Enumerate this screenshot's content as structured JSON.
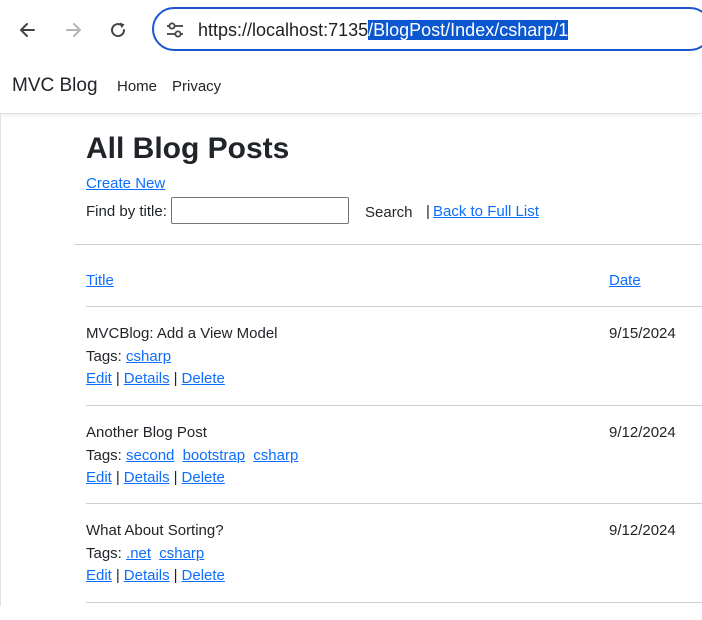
{
  "browser": {
    "url_prefix": "https://localhost:7135",
    "url_selected": "/BlogPost/Index/csharp/1"
  },
  "navbar": {
    "brand": "MVC Blog",
    "links": [
      "Home",
      "Privacy"
    ]
  },
  "page": {
    "title": "All Blog Posts",
    "create_link": "Create New",
    "find_label": "Find by title:",
    "search_value": "",
    "search_button": "Search",
    "separator": "|",
    "back_link": "Back to Full List"
  },
  "table": {
    "col_title": "Title",
    "col_date": "Date",
    "tags_label": "Tags:",
    "actions": {
      "edit": "Edit",
      "details": "Details",
      "delete": "Delete",
      "sep": "|"
    },
    "posts": [
      {
        "title": "MVCBlog: Add a View Model",
        "date": "9/15/2024",
        "tags": [
          "csharp"
        ]
      },
      {
        "title": "Another Blog Post",
        "date": "9/12/2024",
        "tags": [
          "second",
          "bootstrap",
          "csharp"
        ]
      },
      {
        "title": "What About Sorting?",
        "date": "9/12/2024",
        "tags": [
          ".net",
          "csharp"
        ]
      }
    ]
  },
  "colors": {
    "link": "#0d6efd",
    "omnibox_border": "#1a57d0",
    "url_selection": "#0b57d0"
  },
  "icons": [
    "back-arrow-icon",
    "forward-arrow-icon",
    "reload-icon",
    "site-settings-icon"
  ]
}
